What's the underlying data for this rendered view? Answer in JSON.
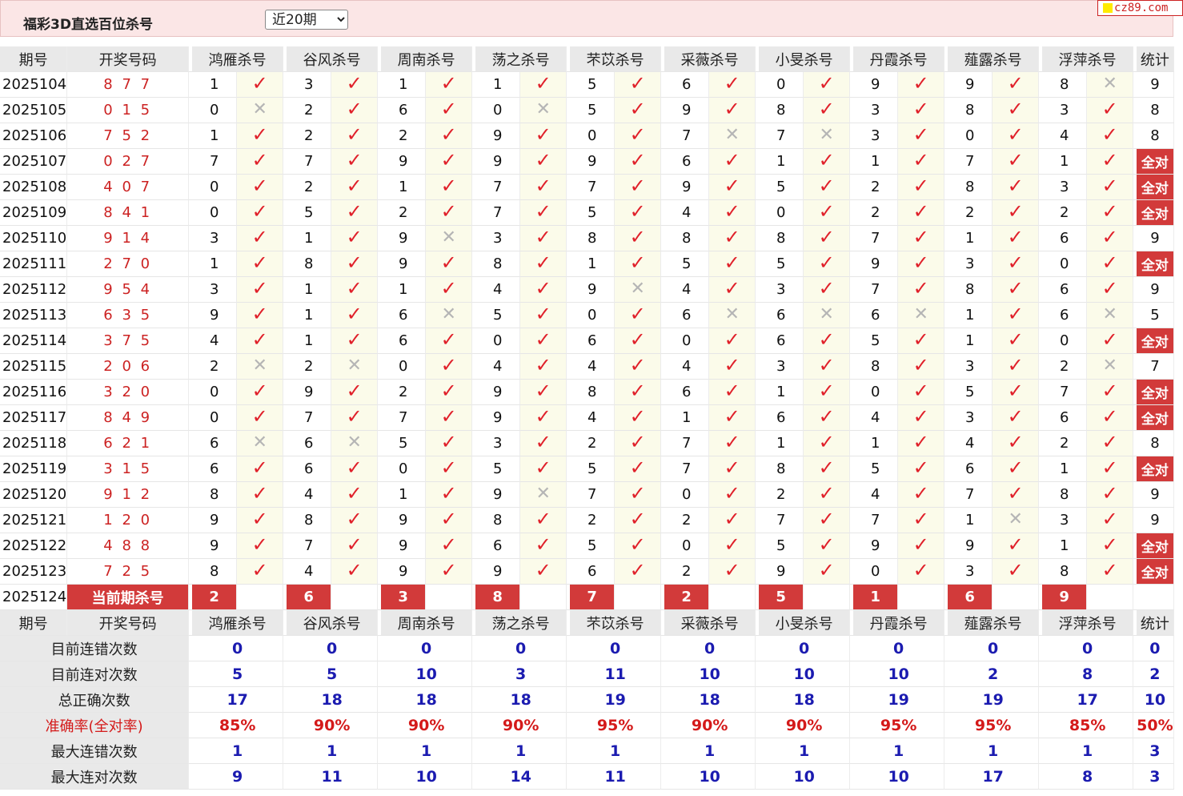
{
  "title": "福彩3D直选百位杀号",
  "period_select": {
    "selected": "近20期",
    "arrow": "chevron-down-icon"
  },
  "logo": {
    "text": "cz89.com"
  },
  "colors": {
    "accent": "#d23a3a",
    "mark_bg": "#fbfbea",
    "header_bg": "#e9e9e9",
    "stat_blue": "#1b1bb0"
  },
  "header": {
    "issue": "期号",
    "draw": "开奖号码",
    "experts": [
      "鸿雁杀号",
      "谷风杀号",
      "周南杀号",
      "荡之杀号",
      "芣苡杀号",
      "采薇杀号",
      "小旻杀号",
      "丹霞杀号",
      "薤露杀号",
      "浮萍杀号"
    ],
    "stat": "统计"
  },
  "rows": [
    {
      "issue": "2025104",
      "draw": "8 7 7",
      "kills": [
        [
          "1",
          1
        ],
        [
          "3",
          1
        ],
        [
          "1",
          1
        ],
        [
          "1",
          1
        ],
        [
          "5",
          1
        ],
        [
          "6",
          1
        ],
        [
          "0",
          1
        ],
        [
          "9",
          1
        ],
        [
          "9",
          1
        ],
        [
          "8",
          0
        ]
      ],
      "stat": "9"
    },
    {
      "issue": "2025105",
      "draw": "0 1 5",
      "kills": [
        [
          "0",
          0
        ],
        [
          "2",
          1
        ],
        [
          "6",
          1
        ],
        [
          "0",
          0
        ],
        [
          "5",
          1
        ],
        [
          "9",
          1
        ],
        [
          "8",
          1
        ],
        [
          "3",
          1
        ],
        [
          "8",
          1
        ],
        [
          "3",
          1
        ]
      ],
      "stat": "8"
    },
    {
      "issue": "2025106",
      "draw": "7 5 2",
      "kills": [
        [
          "1",
          1
        ],
        [
          "2",
          1
        ],
        [
          "2",
          1
        ],
        [
          "9",
          1
        ],
        [
          "0",
          1
        ],
        [
          "7",
          0
        ],
        [
          "7",
          0
        ],
        [
          "3",
          1
        ],
        [
          "0",
          1
        ],
        [
          "4",
          1
        ]
      ],
      "stat": "8"
    },
    {
      "issue": "2025107",
      "draw": "0 2 7",
      "kills": [
        [
          "7",
          1
        ],
        [
          "7",
          1
        ],
        [
          "9",
          1
        ],
        [
          "9",
          1
        ],
        [
          "9",
          1
        ],
        [
          "6",
          1
        ],
        [
          "1",
          1
        ],
        [
          "1",
          1
        ],
        [
          "7",
          1
        ],
        [
          "1",
          1
        ]
      ],
      "stat": "全对"
    },
    {
      "issue": "2025108",
      "draw": "4 0 7",
      "kills": [
        [
          "0",
          1
        ],
        [
          "2",
          1
        ],
        [
          "1",
          1
        ],
        [
          "7",
          1
        ],
        [
          "7",
          1
        ],
        [
          "9",
          1
        ],
        [
          "5",
          1
        ],
        [
          "2",
          1
        ],
        [
          "8",
          1
        ],
        [
          "3",
          1
        ]
      ],
      "stat": "全对"
    },
    {
      "issue": "2025109",
      "draw": "8 4 1",
      "kills": [
        [
          "0",
          1
        ],
        [
          "5",
          1
        ],
        [
          "2",
          1
        ],
        [
          "7",
          1
        ],
        [
          "5",
          1
        ],
        [
          "4",
          1
        ],
        [
          "0",
          1
        ],
        [
          "2",
          1
        ],
        [
          "2",
          1
        ],
        [
          "2",
          1
        ]
      ],
      "stat": "全对"
    },
    {
      "issue": "2025110",
      "draw": "9 1 4",
      "kills": [
        [
          "3",
          1
        ],
        [
          "1",
          1
        ],
        [
          "9",
          0
        ],
        [
          "3",
          1
        ],
        [
          "8",
          1
        ],
        [
          "8",
          1
        ],
        [
          "8",
          1
        ],
        [
          "7",
          1
        ],
        [
          "1",
          1
        ],
        [
          "6",
          1
        ]
      ],
      "stat": "9"
    },
    {
      "issue": "2025111",
      "draw": "2 7 0",
      "kills": [
        [
          "1",
          1
        ],
        [
          "8",
          1
        ],
        [
          "9",
          1
        ],
        [
          "8",
          1
        ],
        [
          "1",
          1
        ],
        [
          "5",
          1
        ],
        [
          "5",
          1
        ],
        [
          "9",
          1
        ],
        [
          "3",
          1
        ],
        [
          "0",
          1
        ]
      ],
      "stat": "全对"
    },
    {
      "issue": "2025112",
      "draw": "9 5 4",
      "kills": [
        [
          "3",
          1
        ],
        [
          "1",
          1
        ],
        [
          "1",
          1
        ],
        [
          "4",
          1
        ],
        [
          "9",
          0
        ],
        [
          "4",
          1
        ],
        [
          "3",
          1
        ],
        [
          "7",
          1
        ],
        [
          "8",
          1
        ],
        [
          "6",
          1
        ]
      ],
      "stat": "9"
    },
    {
      "issue": "2025113",
      "draw": "6 3 5",
      "kills": [
        [
          "9",
          1
        ],
        [
          "1",
          1
        ],
        [
          "6",
          0
        ],
        [
          "5",
          1
        ],
        [
          "0",
          1
        ],
        [
          "6",
          0
        ],
        [
          "6",
          0
        ],
        [
          "6",
          0
        ],
        [
          "1",
          1
        ],
        [
          "6",
          0
        ]
      ],
      "stat": "5"
    },
    {
      "issue": "2025114",
      "draw": "3 7 5",
      "kills": [
        [
          "4",
          1
        ],
        [
          "1",
          1
        ],
        [
          "6",
          1
        ],
        [
          "0",
          1
        ],
        [
          "6",
          1
        ],
        [
          "0",
          1
        ],
        [
          "6",
          1
        ],
        [
          "5",
          1
        ],
        [
          "1",
          1
        ],
        [
          "0",
          1
        ]
      ],
      "stat": "全对"
    },
    {
      "issue": "2025115",
      "draw": "2 0 6",
      "kills": [
        [
          "2",
          0
        ],
        [
          "2",
          0
        ],
        [
          "0",
          1
        ],
        [
          "4",
          1
        ],
        [
          "4",
          1
        ],
        [
          "4",
          1
        ],
        [
          "3",
          1
        ],
        [
          "8",
          1
        ],
        [
          "3",
          1
        ],
        [
          "2",
          0
        ]
      ],
      "stat": "7"
    },
    {
      "issue": "2025116",
      "draw": "3 2 0",
      "kills": [
        [
          "0",
          1
        ],
        [
          "9",
          1
        ],
        [
          "2",
          1
        ],
        [
          "9",
          1
        ],
        [
          "8",
          1
        ],
        [
          "6",
          1
        ],
        [
          "1",
          1
        ],
        [
          "0",
          1
        ],
        [
          "5",
          1
        ],
        [
          "7",
          1
        ]
      ],
      "stat": "全对"
    },
    {
      "issue": "2025117",
      "draw": "8 4 9",
      "kills": [
        [
          "0",
          1
        ],
        [
          "7",
          1
        ],
        [
          "7",
          1
        ],
        [
          "9",
          1
        ],
        [
          "4",
          1
        ],
        [
          "1",
          1
        ],
        [
          "6",
          1
        ],
        [
          "4",
          1
        ],
        [
          "3",
          1
        ],
        [
          "6",
          1
        ]
      ],
      "stat": "全对"
    },
    {
      "issue": "2025118",
      "draw": "6 2 1",
      "kills": [
        [
          "6",
          0
        ],
        [
          "6",
          0
        ],
        [
          "5",
          1
        ],
        [
          "3",
          1
        ],
        [
          "2",
          1
        ],
        [
          "7",
          1
        ],
        [
          "1",
          1
        ],
        [
          "1",
          1
        ],
        [
          "4",
          1
        ],
        [
          "2",
          1
        ]
      ],
      "stat": "8"
    },
    {
      "issue": "2025119",
      "draw": "3 1 5",
      "kills": [
        [
          "6",
          1
        ],
        [
          "6",
          1
        ],
        [
          "0",
          1
        ],
        [
          "5",
          1
        ],
        [
          "5",
          1
        ],
        [
          "7",
          1
        ],
        [
          "8",
          1
        ],
        [
          "5",
          1
        ],
        [
          "6",
          1
        ],
        [
          "1",
          1
        ]
      ],
      "stat": "全对"
    },
    {
      "issue": "2025120",
      "draw": "9 1 2",
      "kills": [
        [
          "8",
          1
        ],
        [
          "4",
          1
        ],
        [
          "1",
          1
        ],
        [
          "9",
          0
        ],
        [
          "7",
          1
        ],
        [
          "0",
          1
        ],
        [
          "2",
          1
        ],
        [
          "4",
          1
        ],
        [
          "7",
          1
        ],
        [
          "8",
          1
        ]
      ],
      "stat": "9"
    },
    {
      "issue": "2025121",
      "draw": "1 2 0",
      "kills": [
        [
          "9",
          1
        ],
        [
          "8",
          1
        ],
        [
          "9",
          1
        ],
        [
          "8",
          1
        ],
        [
          "2",
          1
        ],
        [
          "2",
          1
        ],
        [
          "7",
          1
        ],
        [
          "7",
          1
        ],
        [
          "1",
          0
        ],
        [
          "3",
          1
        ]
      ],
      "stat": "9"
    },
    {
      "issue": "2025122",
      "draw": "4 8 8",
      "kills": [
        [
          "9",
          1
        ],
        [
          "7",
          1
        ],
        [
          "9",
          1
        ],
        [
          "6",
          1
        ],
        [
          "5",
          1
        ],
        [
          "0",
          1
        ],
        [
          "5",
          1
        ],
        [
          "9",
          1
        ],
        [
          "9",
          1
        ],
        [
          "1",
          1
        ]
      ],
      "stat": "全对"
    },
    {
      "issue": "2025123",
      "draw": "7 2 5",
      "kills": [
        [
          "8",
          1
        ],
        [
          "4",
          1
        ],
        [
          "9",
          1
        ],
        [
          "9",
          1
        ],
        [
          "6",
          1
        ],
        [
          "2",
          1
        ],
        [
          "9",
          1
        ],
        [
          "0",
          1
        ],
        [
          "3",
          1
        ],
        [
          "8",
          1
        ]
      ],
      "stat": "全对"
    }
  ],
  "current": {
    "issue": "2025124",
    "label": "当前期杀号",
    "kills": [
      "2",
      "6",
      "3",
      "8",
      "7",
      "2",
      "5",
      "1",
      "6",
      "9"
    ]
  },
  "stats": [
    {
      "label": "目前连错次数",
      "values": [
        "0",
        "0",
        "0",
        "0",
        "0",
        "0",
        "0",
        "0",
        "0",
        "0",
        "0"
      ]
    },
    {
      "label": "目前连对次数",
      "values": [
        "5",
        "5",
        "10",
        "3",
        "11",
        "10",
        "10",
        "10",
        "2",
        "8",
        "2"
      ]
    },
    {
      "label": "总正确次数",
      "values": [
        "17",
        "18",
        "18",
        "18",
        "19",
        "18",
        "18",
        "19",
        "19",
        "17",
        "10"
      ]
    },
    {
      "label": "准确率(全对率)",
      "values": [
        "85%",
        "90%",
        "90%",
        "90%",
        "95%",
        "90%",
        "90%",
        "95%",
        "95%",
        "85%",
        "50%"
      ]
    },
    {
      "label": "最大连错次数",
      "values": [
        "1",
        "1",
        "1",
        "1",
        "1",
        "1",
        "1",
        "1",
        "1",
        "1",
        "3"
      ]
    },
    {
      "label": "最大连对次数",
      "values": [
        "9",
        "11",
        "10",
        "14",
        "11",
        "10",
        "10",
        "10",
        "17",
        "8",
        "3"
      ]
    }
  ]
}
